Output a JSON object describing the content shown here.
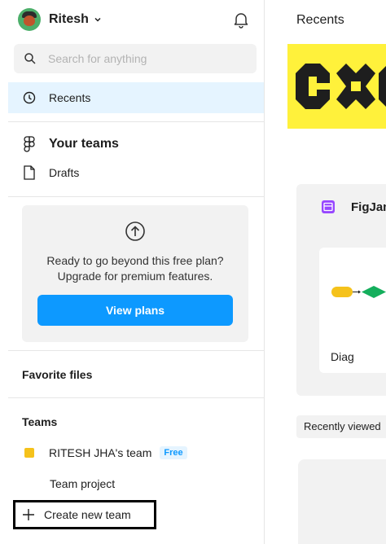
{
  "sidebar": {
    "user": {
      "name": "Ritesh"
    },
    "search": {
      "placeholder": "Search for anything"
    },
    "nav": {
      "recents_label": "Recents",
      "your_teams_label": "Your teams",
      "drafts_label": "Drafts"
    },
    "upgrade": {
      "line1": "Ready to go beyond this free plan?",
      "line2": "Upgrade for premium features.",
      "button_label": "View plans"
    },
    "favorites_label": "Favorite files",
    "teams_label": "Teams",
    "team": {
      "name": "RITESH JHA's team",
      "badge": "Free"
    },
    "team_project_label": "Team project",
    "create_team_label": "Create new team"
  },
  "main": {
    "title": "Recents",
    "figjam_label": "FigJam",
    "diagram_label": "Diag",
    "recently_viewed_label": "Recently viewed"
  },
  "colors": {
    "accent_blue": "#0d99ff",
    "active_nav_bg": "#e5f4ff",
    "banner_yellow": "#fff13b",
    "team_swatch": "#f5c21b",
    "figjam_purple": "#9747ff",
    "node_yellow": "#f5c21b",
    "node_green": "#14ae5c"
  },
  "icons": [
    "search-icon",
    "clock-icon",
    "figma-logo-icon",
    "file-icon",
    "bell-icon",
    "chevron-down-icon",
    "arrow-up-circle-icon",
    "plus-icon",
    "figjam-icon"
  ]
}
